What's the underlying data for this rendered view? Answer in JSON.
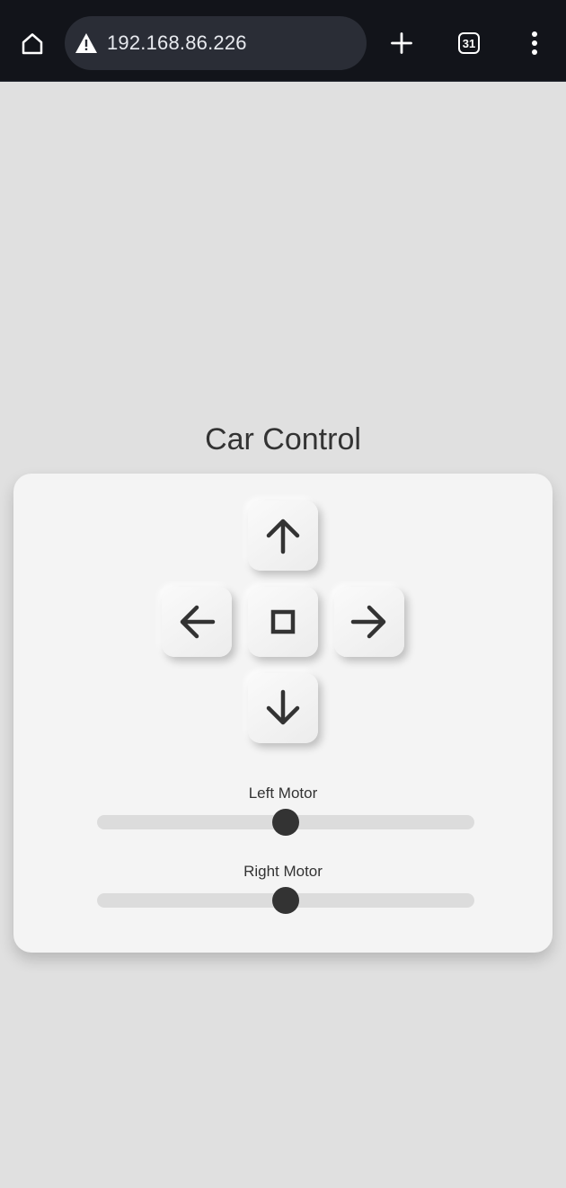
{
  "browser": {
    "url": "192.168.86.226",
    "tab_count": "31",
    "icons": [
      "home-icon",
      "warning-icon",
      "plus-icon",
      "tabs-icon",
      "more-vert-icon"
    ]
  },
  "page": {
    "title": "Car Control",
    "controls": {
      "up_icon": "arrow-up-icon",
      "left_icon": "arrow-left-icon",
      "stop_icon": "stop-icon",
      "right_icon": "arrow-right-icon",
      "down_icon": "arrow-down-icon"
    },
    "sliders": [
      {
        "label": "Left Motor",
        "value_fraction": 0.5
      },
      {
        "label": "Right Motor",
        "value_fraction": 0.5
      }
    ]
  },
  "colors": {
    "browser_bg": "#12141a",
    "page_bg": "#e0e0e0",
    "panel_bg": "#f4f4f4",
    "text": "#333333",
    "thumb": "#333333",
    "track": "#dcdcdc"
  }
}
